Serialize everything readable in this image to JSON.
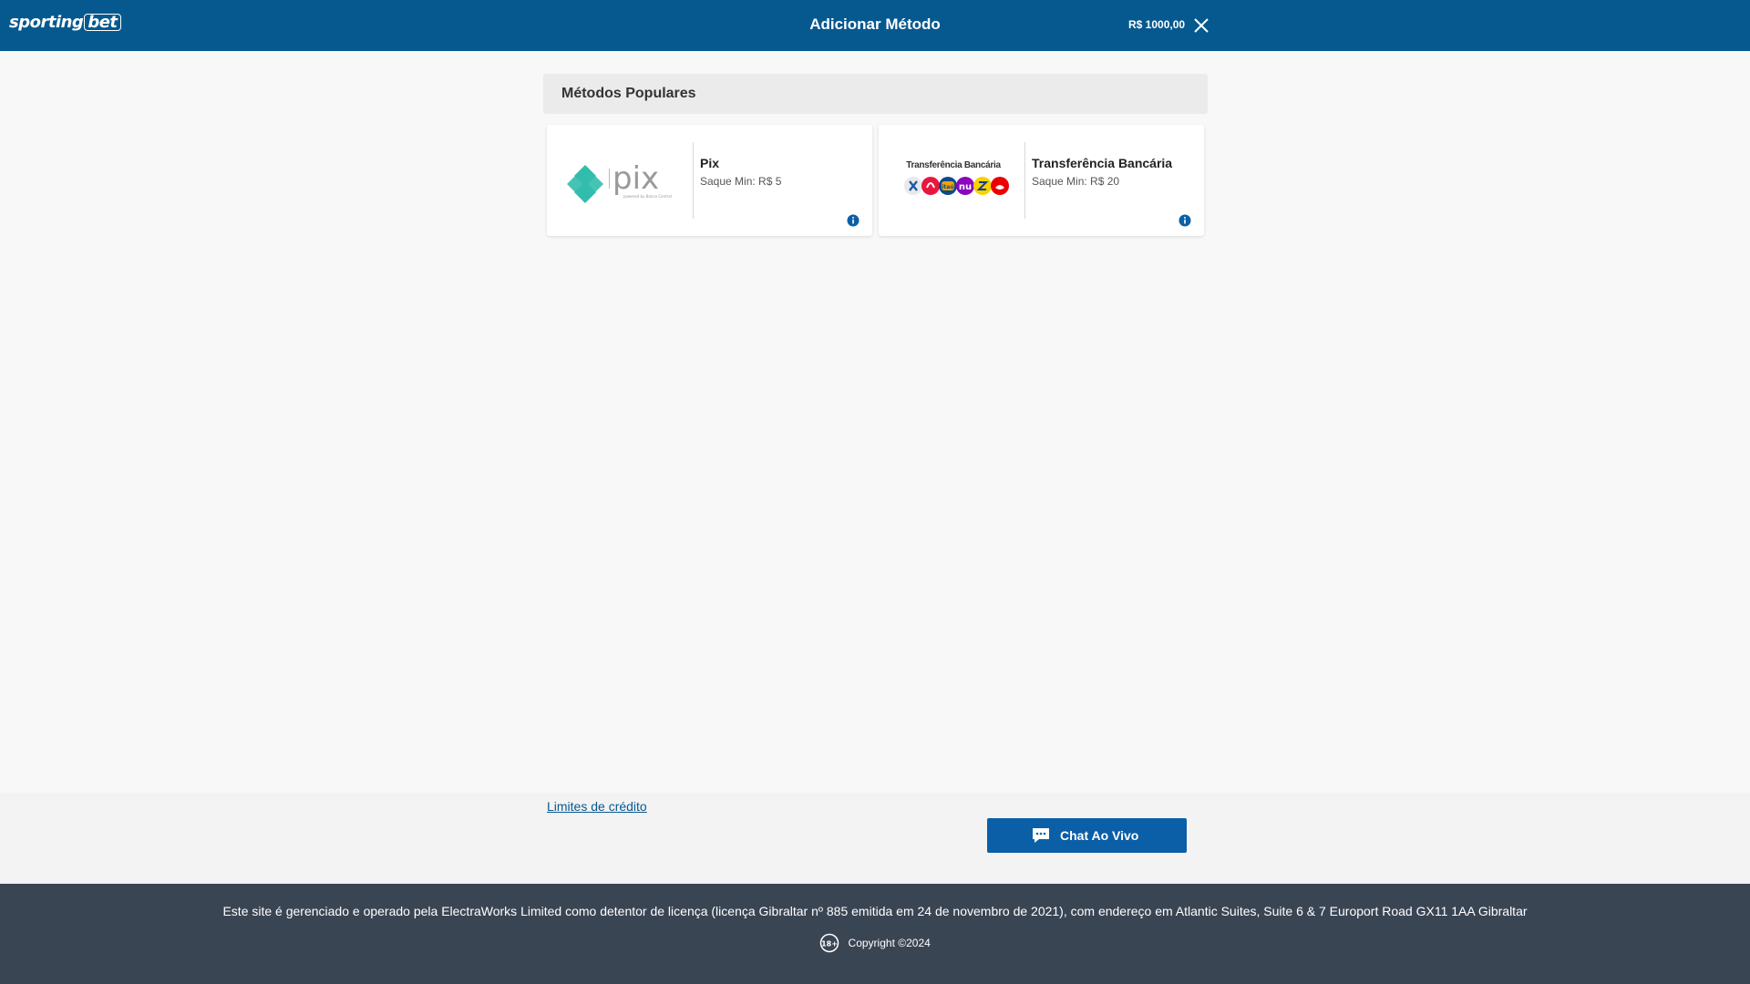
{
  "header": {
    "brand": "sporting",
    "brand_suffix": "bet",
    "title": "Adicionar Método",
    "balance": "R$ 1000,00",
    "close_icon": "close-icon"
  },
  "section": {
    "title": "Métodos Populares"
  },
  "methods": [
    {
      "name": "Pix",
      "min": "Saque Min: R$ 5",
      "logo_text": "pix",
      "logo_subtext": "powered by Banco Central",
      "accent": "#32bcad"
    },
    {
      "name": "Transferência Bancária",
      "min": "Saque Min: R$ 20",
      "logo_text": "Transferência Bancária",
      "bank_colors": [
        "#e9e9e9",
        "#e8173f",
        "#0c4a8c",
        "#8a05be",
        "#f5d400",
        "#ec0000"
      ]
    }
  ],
  "footer": {
    "credit_link": "Limites de crédito",
    "chat_label": "Chat Ao Vivo",
    "license": "Este site é gerenciado e operado pela ElectraWorks Limited como detentor de licença (licença Gibraltar nº 885 emitida em 24 de novembro de 2021), com endereço em Atlantic Suites, Suite 6 & 7 Europort Road GX11 1AA Gibraltar",
    "age_badge": "18+",
    "copyright": "Copyright",
    "year": "©2024"
  },
  "colors": {
    "header_bg": "#06598f",
    "footer_bg": "#3a4554",
    "chat_button": "#0a5fa7",
    "link": "#06598f"
  }
}
